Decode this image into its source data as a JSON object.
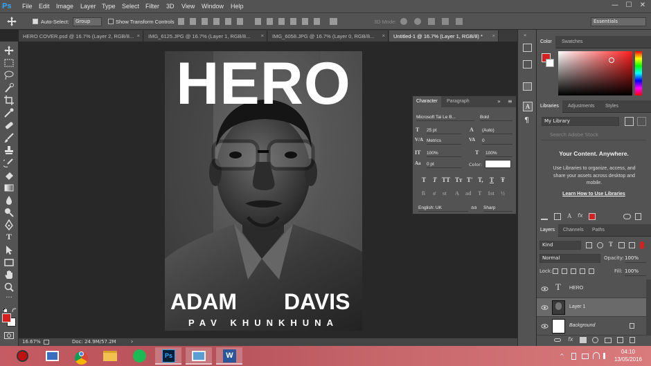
{
  "app": {
    "logo": "Ps"
  },
  "menu": [
    "File",
    "Edit",
    "Image",
    "Layer",
    "Type",
    "Select",
    "Filter",
    "3D",
    "View",
    "Window",
    "Help"
  ],
  "window_controls": {
    "minimize": "—",
    "maximize": "☐",
    "close": "✕"
  },
  "options_bar": {
    "auto_select_label": "Auto-Select:",
    "auto_select_value": "Group",
    "show_transform_label": "Show Transform Controls",
    "mode_3d_label": "3D Mode:",
    "workspace": "Essentials"
  },
  "tabs": [
    {
      "label": "HERO COVER.psd @ 16.7% (Layer 2, RGB/8...",
      "close": "×",
      "active": false
    },
    {
      "label": "IMG_6125.JPG @ 16.7% (Layer 1, RGB/8...",
      "close": "×",
      "active": false
    },
    {
      "label": "IMG_6058.JPG @ 16.7% (Layer 0, RGB/8...",
      "close": "×",
      "active": false
    },
    {
      "label": "Untitled-1 @ 16.7% (Layer 1, RGB/8) *",
      "close": "×",
      "active": true
    }
  ],
  "cover": {
    "title": "HERO",
    "first_name": "ADAM",
    "last_name": "DAVIS",
    "subtitle": "PAV KHUNKHUNA"
  },
  "character_panel": {
    "tabs": [
      "Character",
      "Paragraph"
    ],
    "font_family": "Microsoft Tai Le B...",
    "font_style": "Bold",
    "font_size": "25 pt",
    "leading": "(Auto)",
    "kerning": "Metrics",
    "tracking": "0",
    "vertical_scale": "100%",
    "horizontal_scale": "100%",
    "baseline_shift": "0 pt",
    "color_label": "Color:",
    "color_value": "#ffffff",
    "type_styles_row1": [
      "T",
      "T",
      "TT",
      "Tт",
      "T'",
      "T,",
      "T",
      "Ŧ"
    ],
    "type_styles_row2": [
      "fi",
      "ơ",
      "st",
      "A",
      "ad",
      "T",
      "1st",
      "½"
    ],
    "language": "English: UK",
    "aa_label": "aa",
    "antialias": "Sharp"
  },
  "color_panel": {
    "tabs": [
      "Color",
      "Swatches"
    ],
    "foreground": "#d42020",
    "background": "#ffffff"
  },
  "libraries_panel": {
    "tabs": [
      "Libraries",
      "Adjustments",
      "Styles"
    ],
    "library": "My Library",
    "search_placeholder": "Search Adobe Stock",
    "heading": "Your Content. Anywhere.",
    "body": "Use Libraries to organize, access, and share your assets across desktop and mobile.",
    "link": "Learn How to Use Libraries"
  },
  "layers_panel": {
    "tabs": [
      "Layers",
      "Channels",
      "Paths"
    ],
    "filter_kind": "Kind",
    "blend_mode": "Normal",
    "opacity_label": "Opacity:",
    "opacity": "100%",
    "lock_label": "Lock:",
    "fill_label": "Fill:",
    "fill": "100%",
    "layers": [
      {
        "name": "HERO",
        "type": "text",
        "selected": false
      },
      {
        "name": "Layer 1",
        "type": "image",
        "selected": true
      },
      {
        "name": "Background",
        "type": "background",
        "selected": false
      }
    ]
  },
  "status_bar": {
    "zoom": "16.67%",
    "doc": "Doc: 24.9M/57.2M"
  },
  "taskbar": {
    "time": "04:10",
    "date": "13/05/2016",
    "apps": [
      "power-app",
      "remote-app",
      "chrome",
      "file-explorer",
      "spotify",
      "photoshop",
      "photos",
      "word"
    ]
  }
}
